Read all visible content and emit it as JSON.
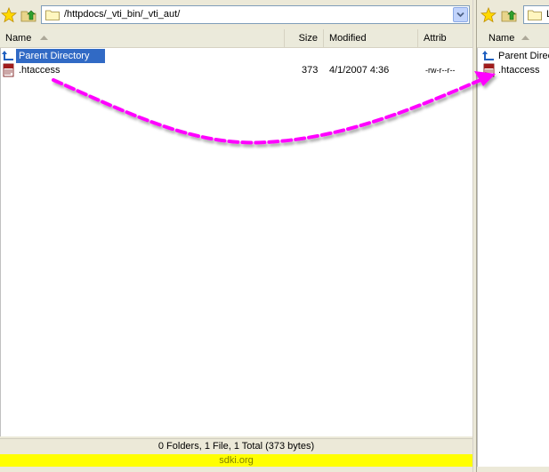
{
  "left": {
    "address": "/httpdocs/_vti_bin/_vti_aut/",
    "columns": {
      "name": "Name",
      "size": "Size",
      "modified": "Modified",
      "attrib": "Attrib"
    },
    "rows": [
      {
        "name": "Parent Directory",
        "size": "",
        "modified": "",
        "attrib": "",
        "icon": "parent-directory-icon"
      },
      {
        "name": ".htaccess",
        "size": "373",
        "modified": "4/1/2007 4:36",
        "attrib": "-rw-r--r--",
        "icon": "htaccess-file-icon"
      }
    ],
    "status": "0 Folders, 1 File, 1 Total (373 bytes)",
    "banner": "sdki.org"
  },
  "right": {
    "address": "L",
    "columns": {
      "name": "Name"
    },
    "rows": [
      {
        "name": "Parent Directory",
        "icon": "parent-directory-icon"
      },
      {
        "name": ".htaccess",
        "icon": "htaccess-file-icon"
      }
    ]
  },
  "annotation": {
    "color": "#ff00ff"
  },
  "colors": {
    "selection": "#316ac5",
    "banner": "#ffff00"
  }
}
